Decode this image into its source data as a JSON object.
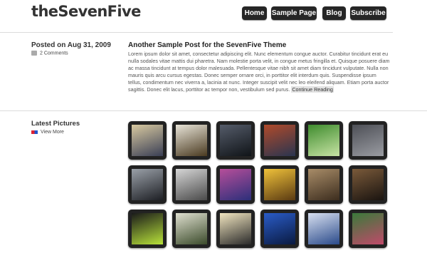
{
  "site": {
    "title": "theSevenFive"
  },
  "nav": [
    {
      "label": "Home"
    },
    {
      "label": "Sample Page"
    },
    {
      "label": "Blog"
    },
    {
      "label": "Subscribe"
    }
  ],
  "post": {
    "date": "Posted on Aug 31, 2009",
    "comments": "2 Comments",
    "title": "Another Sample Post for the SevenFive Theme",
    "excerpt": "Lorem ipsum dolor sit amet, consectetur adipiscing elit. Nunc elementum congue auctor. Curabitur tincidunt erat eu nulla sodales vitae mattis dui pharetra. Nam molestie porta velit, in congue metus fringilla et. Quisque posuere diam ac massa tincidunt at tempus dolor malesuada. Pellentesque vitae nibh sit amet diam tincidunt vulputate. Nulla non mauris quis arcu cursus egestas. Donec semper ornare orci, in porttitor elit interdum quis. Suspendisse ipsum tellus, condimentum nec viverra a, lacinia at nunc. Integer suscipit velit nec leo eleifend aliquam. Etiam porta auctor sagittis. Donec elit lacus, porttitor ac tempor non, vestibulum sed purus.",
    "continue": "Continue Reading"
  },
  "pictures": {
    "title": "Latest Pictures",
    "view_more": "View More",
    "thumbs": [
      {
        "colors": [
          "#d8c9a0",
          "#3a3f55"
        ]
      },
      {
        "colors": [
          "#e8e4d8",
          "#4a3a20"
        ]
      },
      {
        "colors": [
          "#555c6a",
          "#101418"
        ]
      },
      {
        "colors": [
          "#b04a2a",
          "#2a3550"
        ]
      },
      {
        "colors": [
          "#3f8c2e",
          "#c7e3a4"
        ]
      },
      {
        "colors": [
          "#4d4f56",
          "#9a9ca2"
        ]
      },
      {
        "colors": [
          "#9aa0a8",
          "#1d1f24"
        ]
      },
      {
        "colors": [
          "#d6d6d6",
          "#4a4a4a"
        ]
      },
      {
        "colors": [
          "#b64e9a",
          "#2c2f7a"
        ]
      },
      {
        "colors": [
          "#f0c23a",
          "#5a3a12"
        ]
      },
      {
        "colors": [
          "#a88c68",
          "#3c2d1e"
        ]
      },
      {
        "colors": [
          "#7a5a3a",
          "#1a1410"
        ]
      },
      {
        "colors": [
          "#1a1a1a",
          "#b8e23a"
        ]
      },
      {
        "colors": [
          "#e0e0d0",
          "#3a4a2a"
        ]
      },
      {
        "colors": [
          "#f2e6c0",
          "#2a2a2a"
        ]
      },
      {
        "colors": [
          "#2a5cc8",
          "#0a1a40"
        ]
      },
      {
        "colors": [
          "#d8e0f0",
          "#2a4a8a"
        ]
      },
      {
        "colors": [
          "#3a7a3a",
          "#c04a6a"
        ]
      }
    ]
  }
}
